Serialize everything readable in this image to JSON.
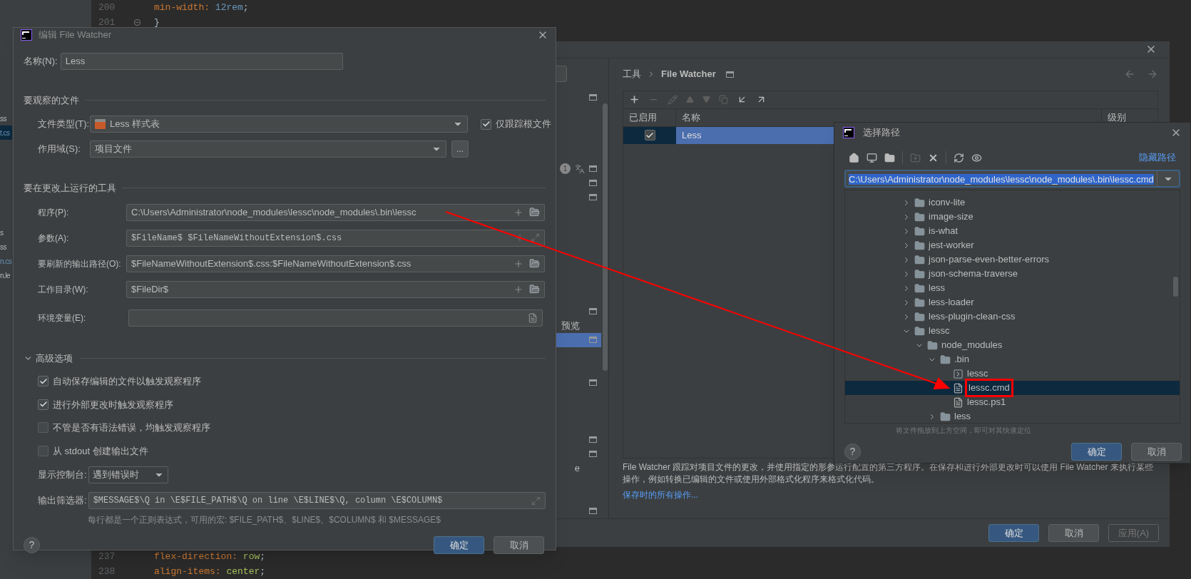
{
  "editor": {
    "top_lines": [
      {
        "number": "200",
        "fold": false,
        "tokens": [
          {
            "text": "min-width: ",
            "kind": "property"
          },
          {
            "text": "12rem",
            "kind": "number"
          },
          {
            "text": ";",
            "kind": "plain"
          }
        ]
      },
      {
        "number": "201",
        "fold": true,
        "tokens": [
          {
            "text": "}",
            "kind": "plain"
          }
        ]
      }
    ],
    "bottom_lines": [
      {
        "number": "237",
        "fold": false,
        "tokens": [
          {
            "text": "flex-direction: ",
            "kind": "property"
          },
          {
            "text": "row",
            "kind": "value"
          },
          {
            "text": ";",
            "kind": "plain"
          }
        ]
      },
      {
        "number": "238",
        "fold": false,
        "tokens": [
          {
            "text": "align-items: ",
            "kind": "property"
          },
          {
            "text": "center",
            "kind": "value"
          },
          {
            "text": ";",
            "kind": "plain"
          }
        ]
      }
    ]
  },
  "project_tree": [
    {
      "kind": "entry",
      "label": "ss",
      "selected": false,
      "modified": false
    },
    {
      "kind": "entry",
      "label": "t.cs",
      "selected": true,
      "modified": true
    },
    {
      "kind": "blank"
    },
    {
      "kind": "blank"
    },
    {
      "kind": "blank"
    },
    {
      "kind": "blank"
    },
    {
      "kind": "blank"
    },
    {
      "kind": "blank"
    },
    {
      "kind": "entry",
      "label": "s",
      "selected": false,
      "modified": false
    },
    {
      "kind": "entry",
      "label": "ss",
      "selected": false,
      "modified": false
    },
    {
      "kind": "entry",
      "label": "n.cs",
      "selected": false,
      "modified": true
    },
    {
      "kind": "entry",
      "label": "n.le",
      "selected": false,
      "modified": false
    }
  ],
  "settings": {
    "sidebar": [
      {
        "kind": "entry",
        "selected": false
      },
      {
        "kind": "blank"
      },
      {
        "kind": "blank"
      },
      {
        "kind": "blank"
      },
      {
        "kind": "blank"
      },
      {
        "kind": "entry",
        "selected": false,
        "badge": "1"
      },
      {
        "kind": "entry",
        "selected": false
      },
      {
        "kind": "entry",
        "selected": false
      },
      {
        "kind": "blank"
      },
      {
        "kind": "blank"
      },
      {
        "kind": "blank"
      },
      {
        "kind": "blank"
      },
      {
        "kind": "blank"
      },
      {
        "kind": "blank"
      },
      {
        "kind": "blank"
      },
      {
        "kind": "entry",
        "selected": false
      },
      {
        "kind": "entry",
        "selected": false,
        "text": "预览"
      },
      {
        "kind": "entry",
        "selected": true
      },
      {
        "kind": "blank"
      },
      {
        "kind": "blank"
      },
      {
        "kind": "entry",
        "selected": false
      },
      {
        "kind": "blank"
      },
      {
        "kind": "blank"
      },
      {
        "kind": "blank"
      },
      {
        "kind": "entry",
        "selected": false
      },
      {
        "kind": "entry",
        "selected": false
      },
      {
        "kind": "entry",
        "selected": false,
        "text": "e"
      },
      {
        "kind": "blank"
      },
      {
        "kind": "blank"
      },
      {
        "kind": "entry",
        "selected": false
      }
    ],
    "breadcrumb": [
      "工具",
      "File Watcher"
    ],
    "columns": [
      "已启用",
      "名称",
      "级别"
    ],
    "rows": [
      {
        "enabled": true,
        "name": "Less",
        "selected": true
      }
    ],
    "description": "File Watcher 跟踪对项目文件的更改，并使用指定的形参运行配置的第三方程序。在保存和进行外部更改时可以使用 File Watcher 来执行某些操作，例如转换已编辑的文件或使用外部格式化程序来格式化代码。",
    "link": "保存时的所有操作...",
    "buttons": [
      {
        "label": "确定",
        "kind": "primary"
      },
      {
        "label": "取消",
        "kind": "normal"
      },
      {
        "label": "应用(A)",
        "kind": "disabled"
      }
    ]
  },
  "edit_dialog": {
    "title": "编辑 File Watcher",
    "name_label": "名称(N):",
    "name_value": "Less",
    "section_files": "要观察的文件",
    "file_type_label": "文件类型(T):",
    "file_type_value": "Less 样式表",
    "track_root_label": "仅跟踪根文件",
    "track_root_checked": true,
    "scope_label": "作用域(S):",
    "scope_value": "项目文件",
    "scope_button": "...",
    "section_tool": "要在更改上运行的工具",
    "tool_fields": [
      {
        "label": "程序(P):",
        "value": "C:\\Users\\Administrator\\node_modules\\lessc\\node_modules\\.bin\\lessc",
        "kind": "path",
        "mono": false
      },
      {
        "label": "参数(A):",
        "value": "$FileName$ $FileNameWithoutExtension$.css",
        "kind": "expand",
        "mono": true
      },
      {
        "label": "要刷新的输出路径(O):",
        "value": "$FileNameWithoutExtension$.css:$FileNameWithoutExtension$.css",
        "kind": "path",
        "mono": false
      },
      {
        "label": "工作目录(W):",
        "value": "$FileDir$",
        "kind": "path",
        "mono": false
      },
      {
        "label": "环境变量(E):",
        "kind": "env"
      }
    ],
    "advanced_label": "高级选项",
    "advanced_expanded": true,
    "options": [
      {
        "label": "自动保存编辑的文件以触发观察程序",
        "checked": true
      },
      {
        "label": "进行外部更改时触发观察程序",
        "checked": true
      },
      {
        "label": "不管是否有语法错误，均触发观察程序",
        "checked": false
      },
      {
        "label": "从 stdout 创建输出文件",
        "checked": false
      }
    ],
    "console_label": "显示控制台:",
    "console_value": "遇到错误时",
    "filter_label": "输出筛选器:",
    "filter_value": "$MESSAGE$\\Q in \\E$FILE_PATH$\\Q on line \\E$LINE$\\Q, column \\E$COLUMN$",
    "filter_hint": "每行都是一个正则表达式，可用的宏: $FILE_PATH$、$LINE$、$COLUMN$ 和 $MESSAGE$",
    "help": "?",
    "buttons": [
      {
        "label": "确定",
        "kind": "primary"
      },
      {
        "label": "取消",
        "kind": "normal"
      }
    ]
  },
  "chooser": {
    "title": "选择路径",
    "hide_path": "隐藏路径",
    "path": "C:\\Users\\Administrator\\node_modules\\lessc\\node_modules\\.bin\\lessc.cmd",
    "tree": [
      {
        "label": "iconv-lite",
        "kind": "folder",
        "expanded": false,
        "selected": false
      },
      {
        "label": "image-size",
        "kind": "folder",
        "expanded": false,
        "selected": false
      },
      {
        "label": "is-what",
        "kind": "folder",
        "expanded": false,
        "selected": false
      },
      {
        "label": "jest-worker",
        "kind": "folder",
        "expanded": false,
        "selected": false
      },
      {
        "label": "json-parse-even-better-errors",
        "kind": "folder",
        "expanded": false,
        "selected": false
      },
      {
        "label": "json-schema-traverse",
        "kind": "folder",
        "expanded": false,
        "selected": false
      },
      {
        "label": "less",
        "kind": "folder",
        "expanded": false,
        "selected": false
      },
      {
        "label": "less-loader",
        "kind": "folder",
        "expanded": false,
        "selected": false
      },
      {
        "label": "less-plugin-clean-css",
        "kind": "folder",
        "expanded": false,
        "selected": false
      },
      {
        "label": "lessc",
        "kind": "folder",
        "expanded": true,
        "selected": false,
        "children": [
          {
            "label": "node_modules",
            "kind": "folder",
            "expanded": true,
            "selected": false,
            "children": [
              {
                "label": ".bin",
                "kind": "folder",
                "expanded": true,
                "selected": false,
                "children": [
                  {
                    "label": "lessc",
                    "kind": "exec",
                    "selected": false
                  },
                  {
                    "label": "lessc.cmd",
                    "kind": "file",
                    "selected": true
                  },
                  {
                    "label": "lessc.ps1",
                    "kind": "file",
                    "selected": false
                  }
                ]
              },
              {
                "label": "less",
                "kind": "folder",
                "expanded": false,
                "selected": false
              }
            ]
          }
        ]
      }
    ],
    "hint": "将文件拖放到上方空间，即可对其快速定位",
    "help": "?",
    "buttons": [
      {
        "label": "确定",
        "kind": "primary"
      },
      {
        "label": "取消",
        "kind": "normal"
      }
    ]
  }
}
